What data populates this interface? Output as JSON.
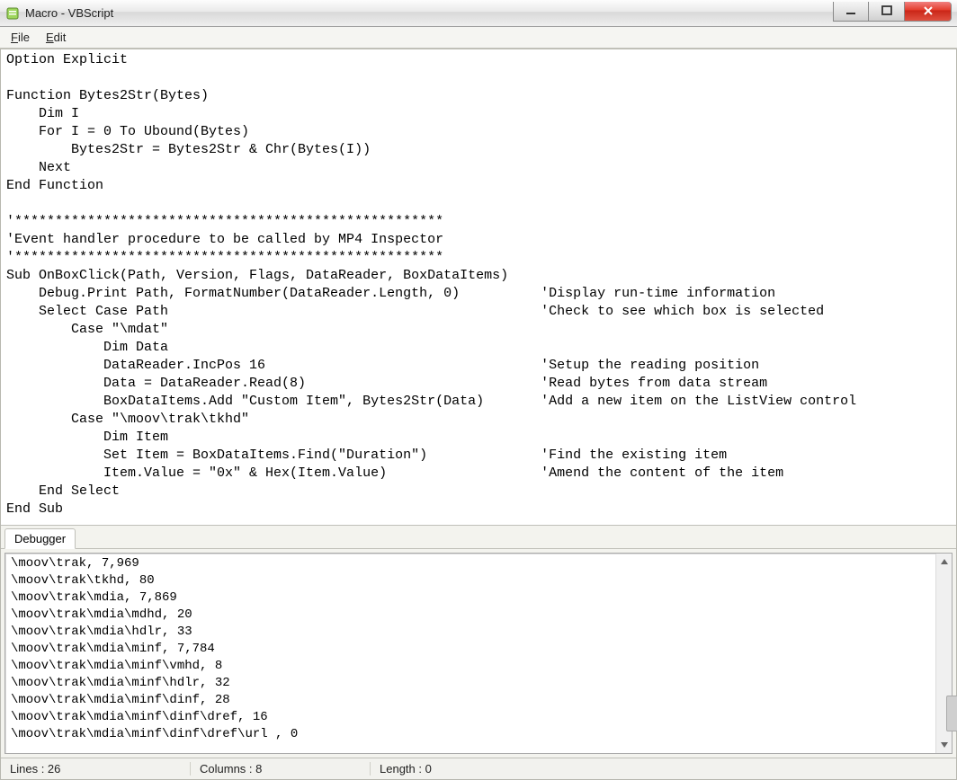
{
  "window": {
    "title": "Macro - VBScript"
  },
  "menu": {
    "file": "File",
    "edit": "Edit"
  },
  "code": "Option Explicit\n\nFunction Bytes2Str(Bytes)\n    Dim I\n    For I = 0 To Ubound(Bytes)\n        Bytes2Str = Bytes2Str & Chr(Bytes(I))\n    Next\nEnd Function\n\n'*****************************************************\n'Event handler procedure to be called by MP4 Inspector\n'*****************************************************\nSub OnBoxClick(Path, Version, Flags, DataReader, BoxDataItems)\n    Debug.Print Path, FormatNumber(DataReader.Length, 0)          'Display run-time information\n    Select Case Path                                              'Check to see which box is selected\n        Case \"\\mdat\"\n            Dim Data\n            DataReader.IncPos 16                                  'Setup the reading position\n            Data = DataReader.Read(8)                             'Read bytes from data stream\n            BoxDataItems.Add \"Custom Item\", Bytes2Str(Data)       'Add a new item on the ListView control\n        Case \"\\moov\\trak\\tkhd\"\n            Dim Item\n            Set Item = BoxDataItems.Find(\"Duration\")              'Find the existing item\n            Item.Value = \"0x\" & Hex(Item.Value)                   'Amend the content of the item\n    End Select\nEnd Sub",
  "tab": {
    "debugger": "Debugger"
  },
  "debugger_output": [
    "\\moov\\trak, 7,969",
    "\\moov\\trak\\tkhd, 80",
    "\\moov\\trak\\mdia, 7,869",
    "\\moov\\trak\\mdia\\mdhd, 20",
    "\\moov\\trak\\mdia\\hdlr, 33",
    "\\moov\\trak\\mdia\\minf, 7,784",
    "\\moov\\trak\\mdia\\minf\\vmhd, 8",
    "\\moov\\trak\\mdia\\minf\\hdlr, 32",
    "\\moov\\trak\\mdia\\minf\\dinf, 28",
    "\\moov\\trak\\mdia\\minf\\dinf\\dref, 16",
    "\\moov\\trak\\mdia\\minf\\dinf\\dref\\url , 0"
  ],
  "status": {
    "lines_label": "Lines : ",
    "lines_value": "26",
    "columns_label": "Columns : ",
    "columns_value": "8",
    "length_label": "Length : ",
    "length_value": "0"
  }
}
